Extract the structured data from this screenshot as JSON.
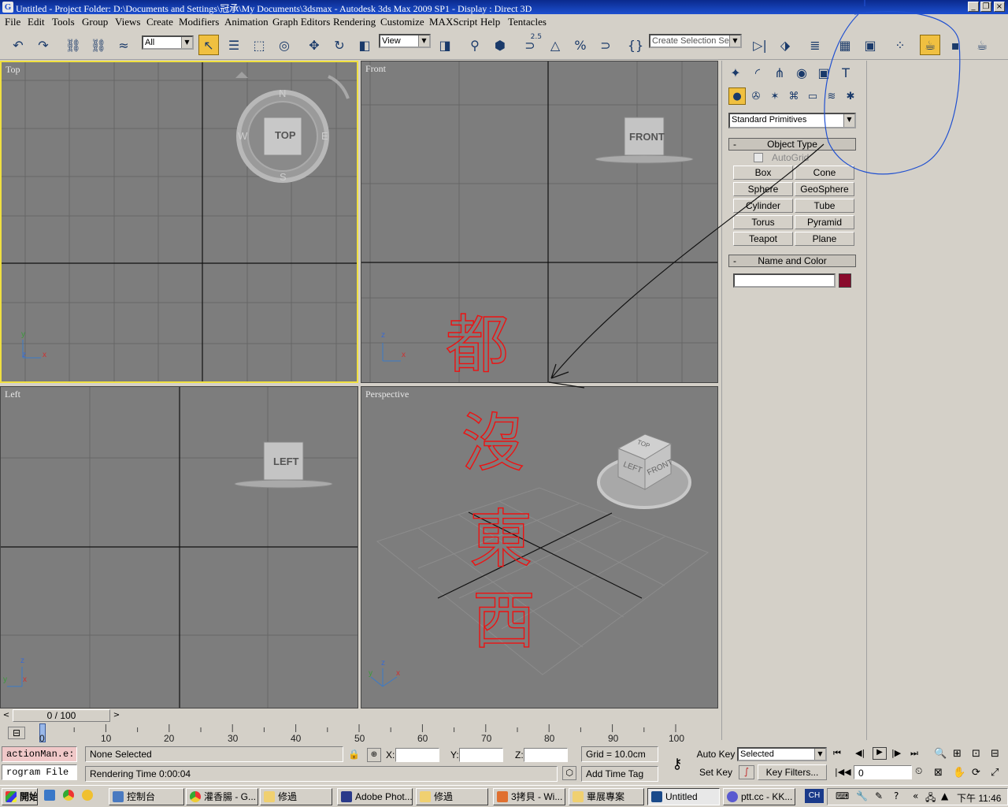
{
  "window": {
    "title": "Untitled     - Project Folder: D:\\Documents and Settings\\冠承\\My Documents\\3dsmax     - Autodesk 3ds Max  2009 SP1      - Display : Direct 3D"
  },
  "menu": [
    "File",
    "Edit",
    "Tools",
    "Group",
    "Views",
    "Create",
    "Modifiers",
    "Animation",
    "Graph Editors",
    "Rendering",
    "Customize",
    "MAXScript",
    "Help",
    "Tentacles"
  ],
  "toolbar": {
    "selection_filter": "All",
    "ref_coord": "View",
    "snap_value": "2.5",
    "named_selection_placeholder": "Create Selection Set"
  },
  "viewports": {
    "top": {
      "label": "Top",
      "cube_label": "TOP",
      "compass": [
        "N",
        "S",
        "W",
        "E"
      ],
      "axes": [
        "y",
        "z",
        "x"
      ]
    },
    "front": {
      "label": "Front",
      "cube_label": "FRONT",
      "axes": [
        "z",
        "x"
      ]
    },
    "left": {
      "label": "Left",
      "cube_label": "LEFT",
      "axes": [
        "z",
        "y",
        "x"
      ]
    },
    "perspective": {
      "label": "Perspective",
      "cube_faces": [
        "TOP",
        "LEFT",
        "FRONT"
      ],
      "axes": [
        "z",
        "y",
        "x"
      ]
    }
  },
  "command_panel": {
    "category": "Standard Primitives",
    "object_type_title": "Object Type",
    "autogrid": "AutoGrid",
    "buttons": [
      "Box",
      "Cone",
      "Sphere",
      "GeoSphere",
      "Cylinder",
      "Tube",
      "Torus",
      "Pyramid",
      "Teapot",
      "Plane"
    ],
    "name_color_title": "Name and Color",
    "object_name": "",
    "object_color": "#8a0a2c"
  },
  "timeline": {
    "slider_label": "0 / 100",
    "ticks": [
      "0",
      "10",
      "20",
      "30",
      "40",
      "50",
      "60",
      "70",
      "80",
      "90",
      "100"
    ],
    "current_frame": 0,
    "total_frames": 100
  },
  "status": {
    "maxscript_line1": "actionMan.e:",
    "maxscript_line2": "rogram File",
    "selection": "None Selected",
    "prompt": "Rendering Time  0:00:04",
    "x_label": "X:",
    "y_label": "Y:",
    "z_label": "Z:",
    "x_value": "",
    "y_value": "",
    "z_value": "",
    "grid": "Grid = 10.0cm",
    "add_time_tag": "Add Time Tag",
    "auto_key": "Auto Key",
    "set_key": "Set Key",
    "key_mode": "Selected",
    "key_filters": "Key Filters...",
    "frame_value": "0"
  },
  "taskbar": {
    "start": "開始",
    "tasks": [
      "控制台",
      "灌香腸 - G...",
      "修過",
      "Adobe Phot...",
      "修過",
      "3拷貝 - Wi...",
      "畢展專案",
      "Untitled",
      "ptt.cc - KK..."
    ],
    "time": "下午 11:46"
  },
  "annotation": {
    "stroke_color": "#ee1111",
    "ink_color": "#2050d0",
    "text_chars": [
      "都",
      "沒",
      "東",
      "西"
    ]
  }
}
